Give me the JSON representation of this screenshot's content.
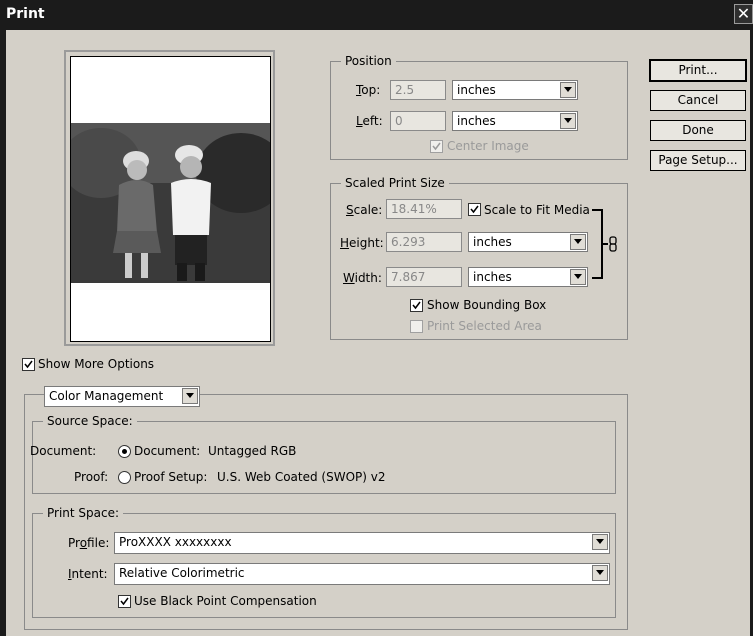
{
  "window": {
    "title": "Print",
    "close_glyph": "✕"
  },
  "position": {
    "legend": "Position",
    "top_label": "Top:",
    "top_value": "2.5",
    "top_unit": "inches",
    "left_label": "Left:",
    "left_value": "0",
    "left_unit": "inches",
    "center_image_label": "Center Image",
    "center_image_checked": true
  },
  "scaled": {
    "legend": "Scaled Print Size",
    "scale_label": "Scale:",
    "scale_value": "18.41%",
    "fit_media_label": "Scale to Fit Media",
    "fit_media_checked": true,
    "height_label": "Height:",
    "height_value": "6.293",
    "height_unit": "inches",
    "width_label": "Width:",
    "width_value": "7.867",
    "width_unit": "inches",
    "bounding_box_label": "Show Bounding Box",
    "bounding_box_checked": true,
    "print_selected_label": "Print Selected Area",
    "print_selected_checked": false
  },
  "buttons": {
    "print": "Print...",
    "cancel": "Cancel",
    "done": "Done",
    "page_setup": "Page Setup..."
  },
  "more_options": {
    "label": "Show More Options",
    "checked": true
  },
  "color_mgmt": {
    "dropdown_value": "Color Management",
    "source_legend": "Source Space:",
    "document_label": "Document:",
    "document_option": "Document:",
    "document_value": "Untagged RGB",
    "proof_label": "Proof:",
    "proof_option": "Proof Setup:",
    "proof_value": "U.S. Web Coated (SWOP) v2",
    "print_legend": "Print Space:",
    "profile_label": "Profile:",
    "profile_value": "ProXXXX xxxxxxxx",
    "intent_label": "Intent:",
    "intent_value": "Relative Colorimetric",
    "bpc_label": "Use Black Point Compensation",
    "bpc_checked": true
  }
}
